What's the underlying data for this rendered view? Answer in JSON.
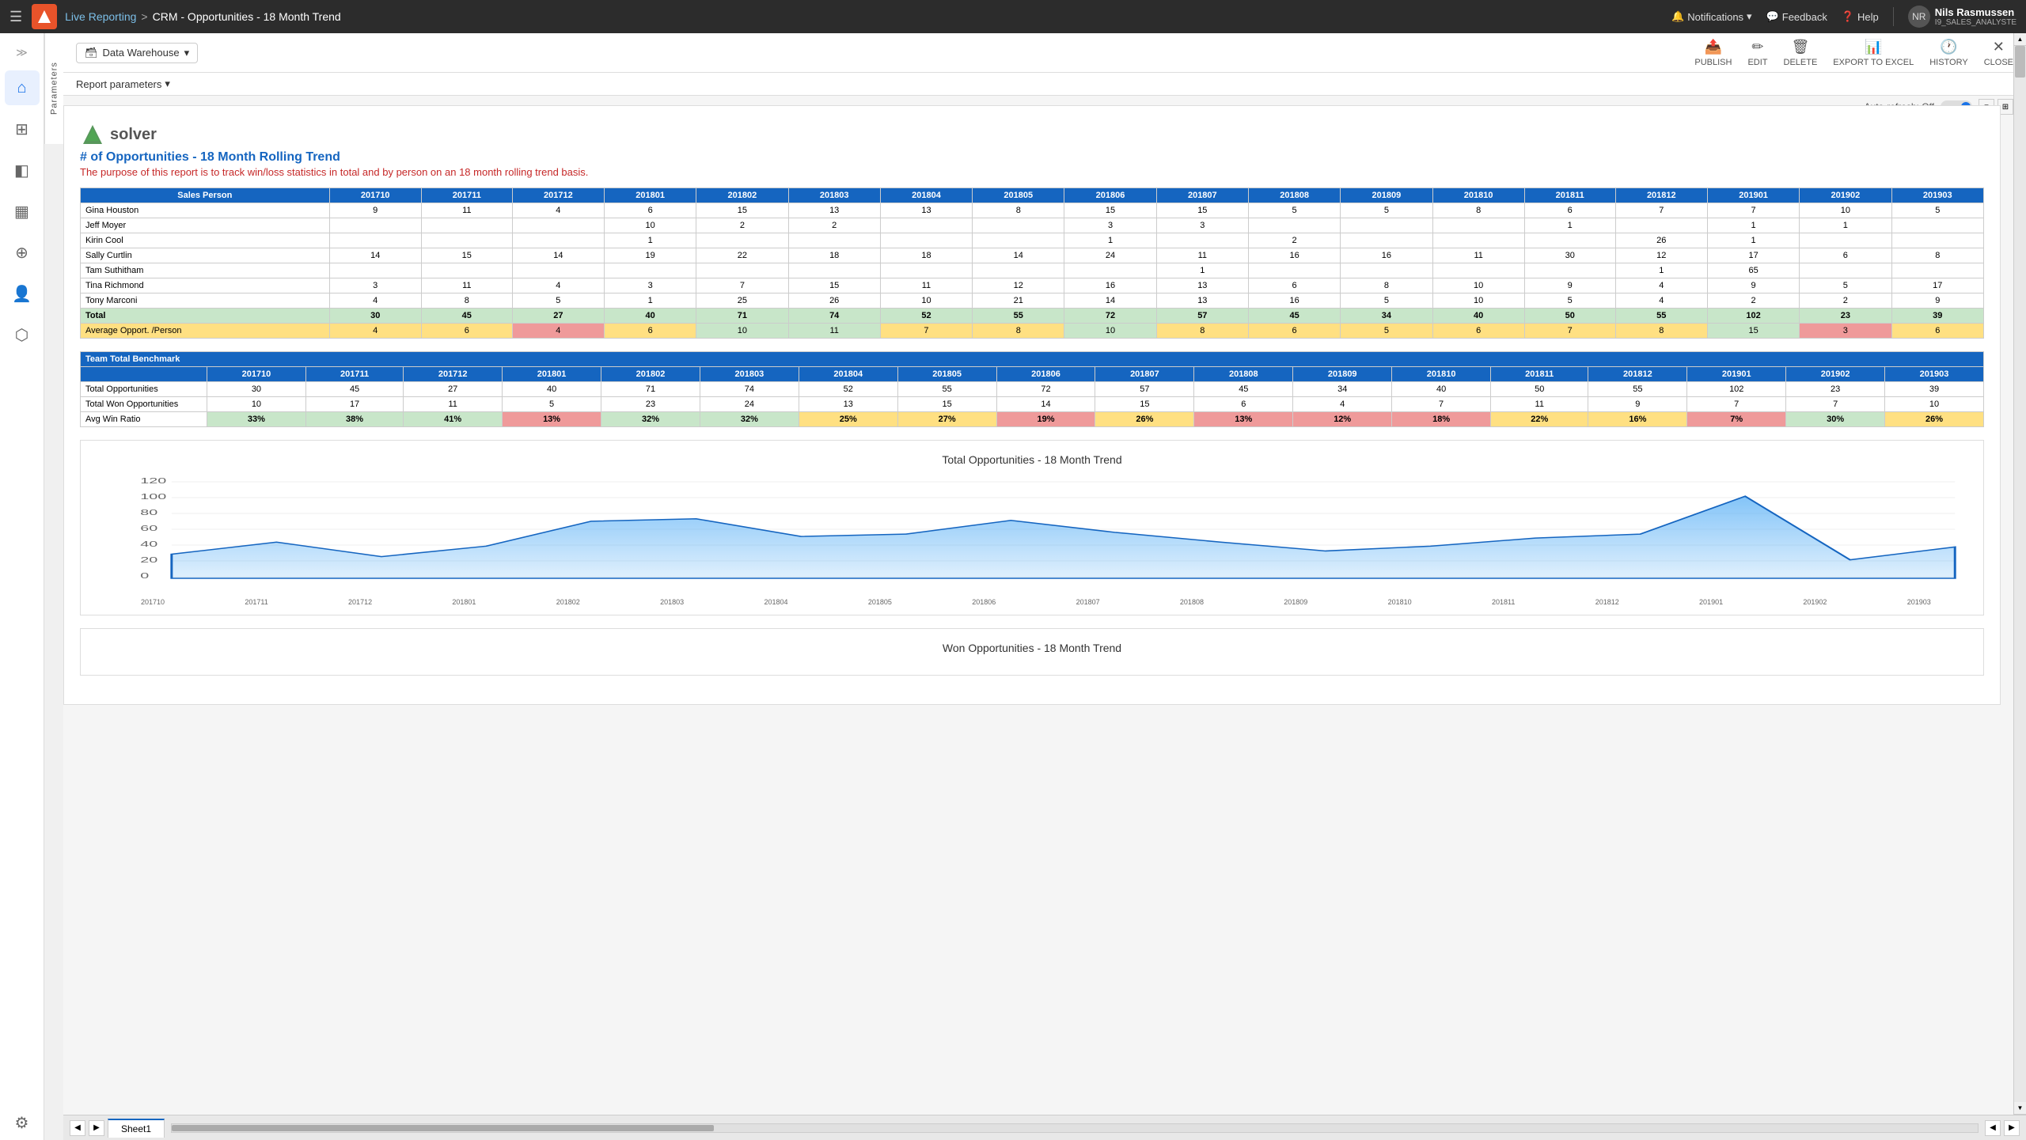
{
  "app": {
    "logo_text": "S",
    "hamburger": "☰"
  },
  "topnav": {
    "breadcrumb_home": "Live Reporting",
    "breadcrumb_sep": ">",
    "breadcrumb_current": "CRM - Opportunities - 18 Month Trend",
    "notifications_label": "Notifications",
    "feedback_label": "Feedback",
    "help_label": "Help",
    "user_name": "Nils Rasmussen",
    "user_role": "I9_SALES_ANALYSTE"
  },
  "toolbar": {
    "warehouse_label": "Data Warehouse",
    "publish_label": "PUBLISH",
    "edit_label": "EDIT",
    "delete_label": "DELETE",
    "export_label": "EXPORT TO EXCEL",
    "history_label": "HISTORY",
    "close_label": "CLOSE"
  },
  "params": {
    "label": "Report parameters"
  },
  "auto_refresh": {
    "label": "Auto-refresh: Off"
  },
  "report": {
    "logo_text": "solver",
    "title": "# of Opportunities - 18 Month Rolling Trend",
    "subtitle": "The purpose of this report is to track win/loss statistics in total and by person on an 18 month rolling trend basis.",
    "columns": [
      "Sales Person",
      "201710",
      "201711",
      "201712",
      "201801",
      "201802",
      "201803",
      "201804",
      "201805",
      "201806",
      "201807",
      "201808",
      "201809",
      "201810",
      "201811",
      "201812",
      "201901",
      "201902",
      "201903"
    ],
    "rows": [
      {
        "name": "Gina Houston",
        "vals": [
          "9",
          "11",
          "4",
          "6",
          "15",
          "13",
          "13",
          "8",
          "15",
          "15",
          "5",
          "5",
          "8",
          "6",
          "7",
          "7",
          "10",
          "5"
        ]
      },
      {
        "name": "Jeff Moyer",
        "vals": [
          "",
          "",
          "",
          "10",
          "2",
          "2",
          "",
          "",
          "3",
          "3",
          "",
          "",
          "",
          "1",
          "",
          "1",
          "1",
          ""
        ]
      },
      {
        "name": "Kirin Cool",
        "vals": [
          "",
          "",
          "",
          "1",
          "",
          "",
          "",
          "",
          "1",
          "",
          "2",
          "",
          "",
          "",
          "26",
          "1",
          "",
          ""
        ]
      },
      {
        "name": "Sally Curtlin",
        "vals": [
          "14",
          "15",
          "14",
          "19",
          "22",
          "18",
          "18",
          "14",
          "24",
          "11",
          "16",
          "16",
          "11",
          "30",
          "12",
          "17",
          "6",
          "8"
        ]
      },
      {
        "name": "Tam Suthitham",
        "vals": [
          "",
          "",
          "",
          "",
          "",
          "",
          "",
          "",
          "",
          "1",
          "",
          "",
          "",
          "",
          "1",
          "65",
          "",
          ""
        ]
      },
      {
        "name": "Tina Richmond",
        "vals": [
          "3",
          "11",
          "4",
          "3",
          "7",
          "15",
          "11",
          "12",
          "16",
          "13",
          "6",
          "8",
          "10",
          "9",
          "4",
          "9",
          "5",
          "17"
        ]
      },
      {
        "name": "Tony Marconi",
        "vals": [
          "4",
          "8",
          "5",
          "1",
          "25",
          "26",
          "10",
          "21",
          "14",
          "13",
          "16",
          "5",
          "10",
          "5",
          "4",
          "2",
          "2",
          "9"
        ]
      }
    ],
    "total_row": {
      "name": "Total",
      "vals": [
        "30",
        "45",
        "27",
        "40",
        "71",
        "74",
        "52",
        "55",
        "72",
        "57",
        "45",
        "34",
        "40",
        "50",
        "55",
        "102",
        "23",
        "39"
      ]
    },
    "avg_row": {
      "name": "Average Opport. /Person",
      "vals": [
        "4",
        "6",
        "4",
        "6",
        "10",
        "11",
        "7",
        "8",
        "10",
        "8",
        "6",
        "5",
        "6",
        "7",
        "8",
        "15",
        "3",
        "6"
      ]
    },
    "avg_highlights": [
      "yellow",
      "yellow",
      "red",
      "yellow",
      "green",
      "green",
      "yellow",
      "yellow",
      "green",
      "yellow",
      "yellow",
      "yellow",
      "yellow",
      "yellow",
      "yellow",
      "green",
      "red",
      "yellow"
    ],
    "benchmark_header": "Team Total Benchmark",
    "benchmark_columns": [
      "201710",
      "201711",
      "201712",
      "201801",
      "201802",
      "201803",
      "201804",
      "201805",
      "201806",
      "201807",
      "201808",
      "201809",
      "201810",
      "201811",
      "201812",
      "201901",
      "201902",
      "201903"
    ],
    "bench_rows": [
      {
        "name": "Total Opportunities",
        "vals": [
          "30",
          "45",
          "27",
          "40",
          "71",
          "74",
          "52",
          "55",
          "72",
          "57",
          "45",
          "34",
          "40",
          "50",
          "55",
          "102",
          "23",
          "39"
        ]
      },
      {
        "name": "Total Won Opportunities",
        "vals": [
          "10",
          "17",
          "11",
          "5",
          "23",
          "24",
          "13",
          "15",
          "14",
          "15",
          "6",
          "4",
          "7",
          "11",
          "9",
          "7",
          "7",
          "10"
        ]
      },
      {
        "name": "Avg Win Ratio",
        "vals": [
          "33%",
          "38%",
          "41%",
          "13%",
          "32%",
          "32%",
          "25%",
          "27%",
          "19%",
          "26%",
          "13%",
          "12%",
          "18%",
          "22%",
          "16%",
          "7%",
          "30%",
          "26%"
        ]
      }
    ],
    "win_ratio_colors": [
      "green",
      "green",
      "green",
      "red",
      "green",
      "green",
      "yellow",
      "yellow",
      "red",
      "yellow",
      "red",
      "red",
      "red",
      "yellow",
      "yellow",
      "red",
      "green",
      "yellow"
    ],
    "chart1": {
      "title": "Total Opportunities - 18 Month Trend",
      "x_labels": [
        "201710",
        "201711",
        "201712",
        "201801",
        "201802",
        "201803",
        "201804",
        "201805",
        "201806",
        "201807",
        "201808",
        "201809",
        "201810",
        "201811",
        "201812",
        "201901",
        "201902",
        "201903"
      ],
      "y_max": 120,
      "y_labels": [
        "120",
        "100",
        "80",
        "60",
        "40",
        "20",
        "0"
      ],
      "data_points": [
        30,
        45,
        27,
        40,
        71,
        74,
        52,
        55,
        72,
        57,
        45,
        34,
        40,
        50,
        55,
        102,
        23,
        39
      ]
    },
    "chart2": {
      "title": "Won Opportunities - 18 Month Trend"
    }
  },
  "sheet_tabs": [
    {
      "label": "Sheet1",
      "active": true
    }
  ],
  "nav_items": [
    {
      "icon": "⌂",
      "name": "home"
    },
    {
      "icon": "⊞",
      "name": "grid"
    },
    {
      "icon": "◧",
      "name": "reports"
    },
    {
      "icon": "▦",
      "name": "dashboard"
    },
    {
      "icon": "⊕",
      "name": "add"
    },
    {
      "icon": "👤",
      "name": "user"
    },
    {
      "icon": "⬡",
      "name": "shapes"
    },
    {
      "icon": "⚙",
      "name": "settings-bottom"
    }
  ]
}
